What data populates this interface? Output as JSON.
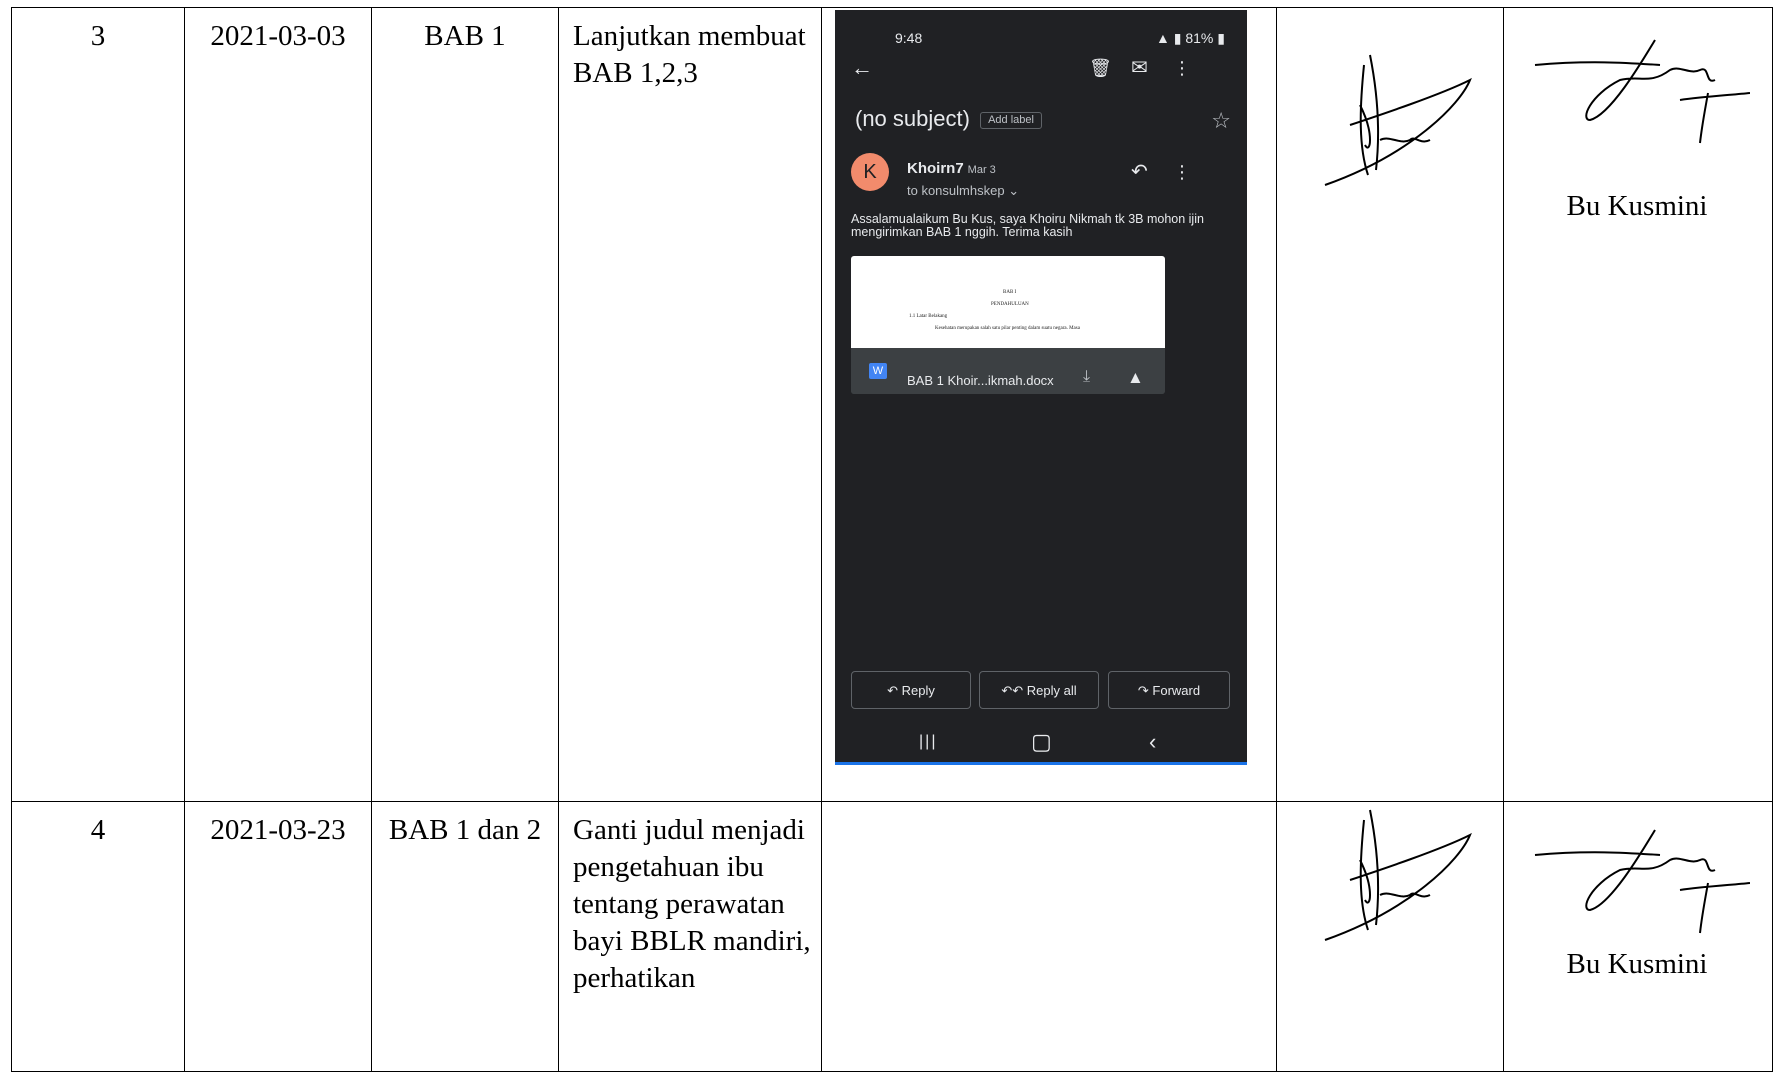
{
  "rows": [
    {
      "no": "3",
      "date": "2021-03-03",
      "topic": "BAB 1",
      "note": "Lanjutkan membuat BAB 1,2,3",
      "advisor": "Bu Kusmini"
    },
    {
      "no": "4",
      "date": "2021-03-23",
      "topic": "BAB 1 dan 2",
      "note": "Ganti judul menjadi pengetahuan ibu tentang perawatan bayi BBLR mandiri, perhatikan",
      "advisor": "Bu Kusmini"
    }
  ],
  "email": {
    "status_time": "9:48",
    "status_battery": "81%",
    "subject": "(no subject)",
    "add_label": "Add label",
    "avatar_letter": "K",
    "sender": "Khoirn7",
    "date": "Mar 3",
    "recipient": "to konsulmhskep",
    "body": "Assalamualaikum Bu Kus, saya Khoiru Nikmah tk 3B mohon ijin mengirimkan BAB 1 nggih. Terima kasih",
    "attachment_icon_letter": "W",
    "attachment_name": "BAB 1 Khoir...ikmah.docx",
    "preview_heading": "BAB I",
    "preview_subheading": "PENDAHULUAN",
    "preview_section": "1.1 Latar Belakang",
    "preview_line": "Kesehatan merupakan salah satu pilar penting dalam suatu negara. Masa",
    "reply": "Reply",
    "reply_all": "Reply all",
    "forward": "Forward"
  },
  "icons": {
    "back": "back-arrow-icon",
    "delete": "trash-icon",
    "mail": "mail-icon",
    "more": "more-vert-icon",
    "star": "star-icon",
    "reply": "reply-icon",
    "download": "download-icon",
    "drive": "drive-icon"
  },
  "colors": {
    "email_bg": "#202124",
    "avatar": "#f28b6c",
    "word_icon": "#4285f4",
    "underline": "#1a73e8"
  }
}
